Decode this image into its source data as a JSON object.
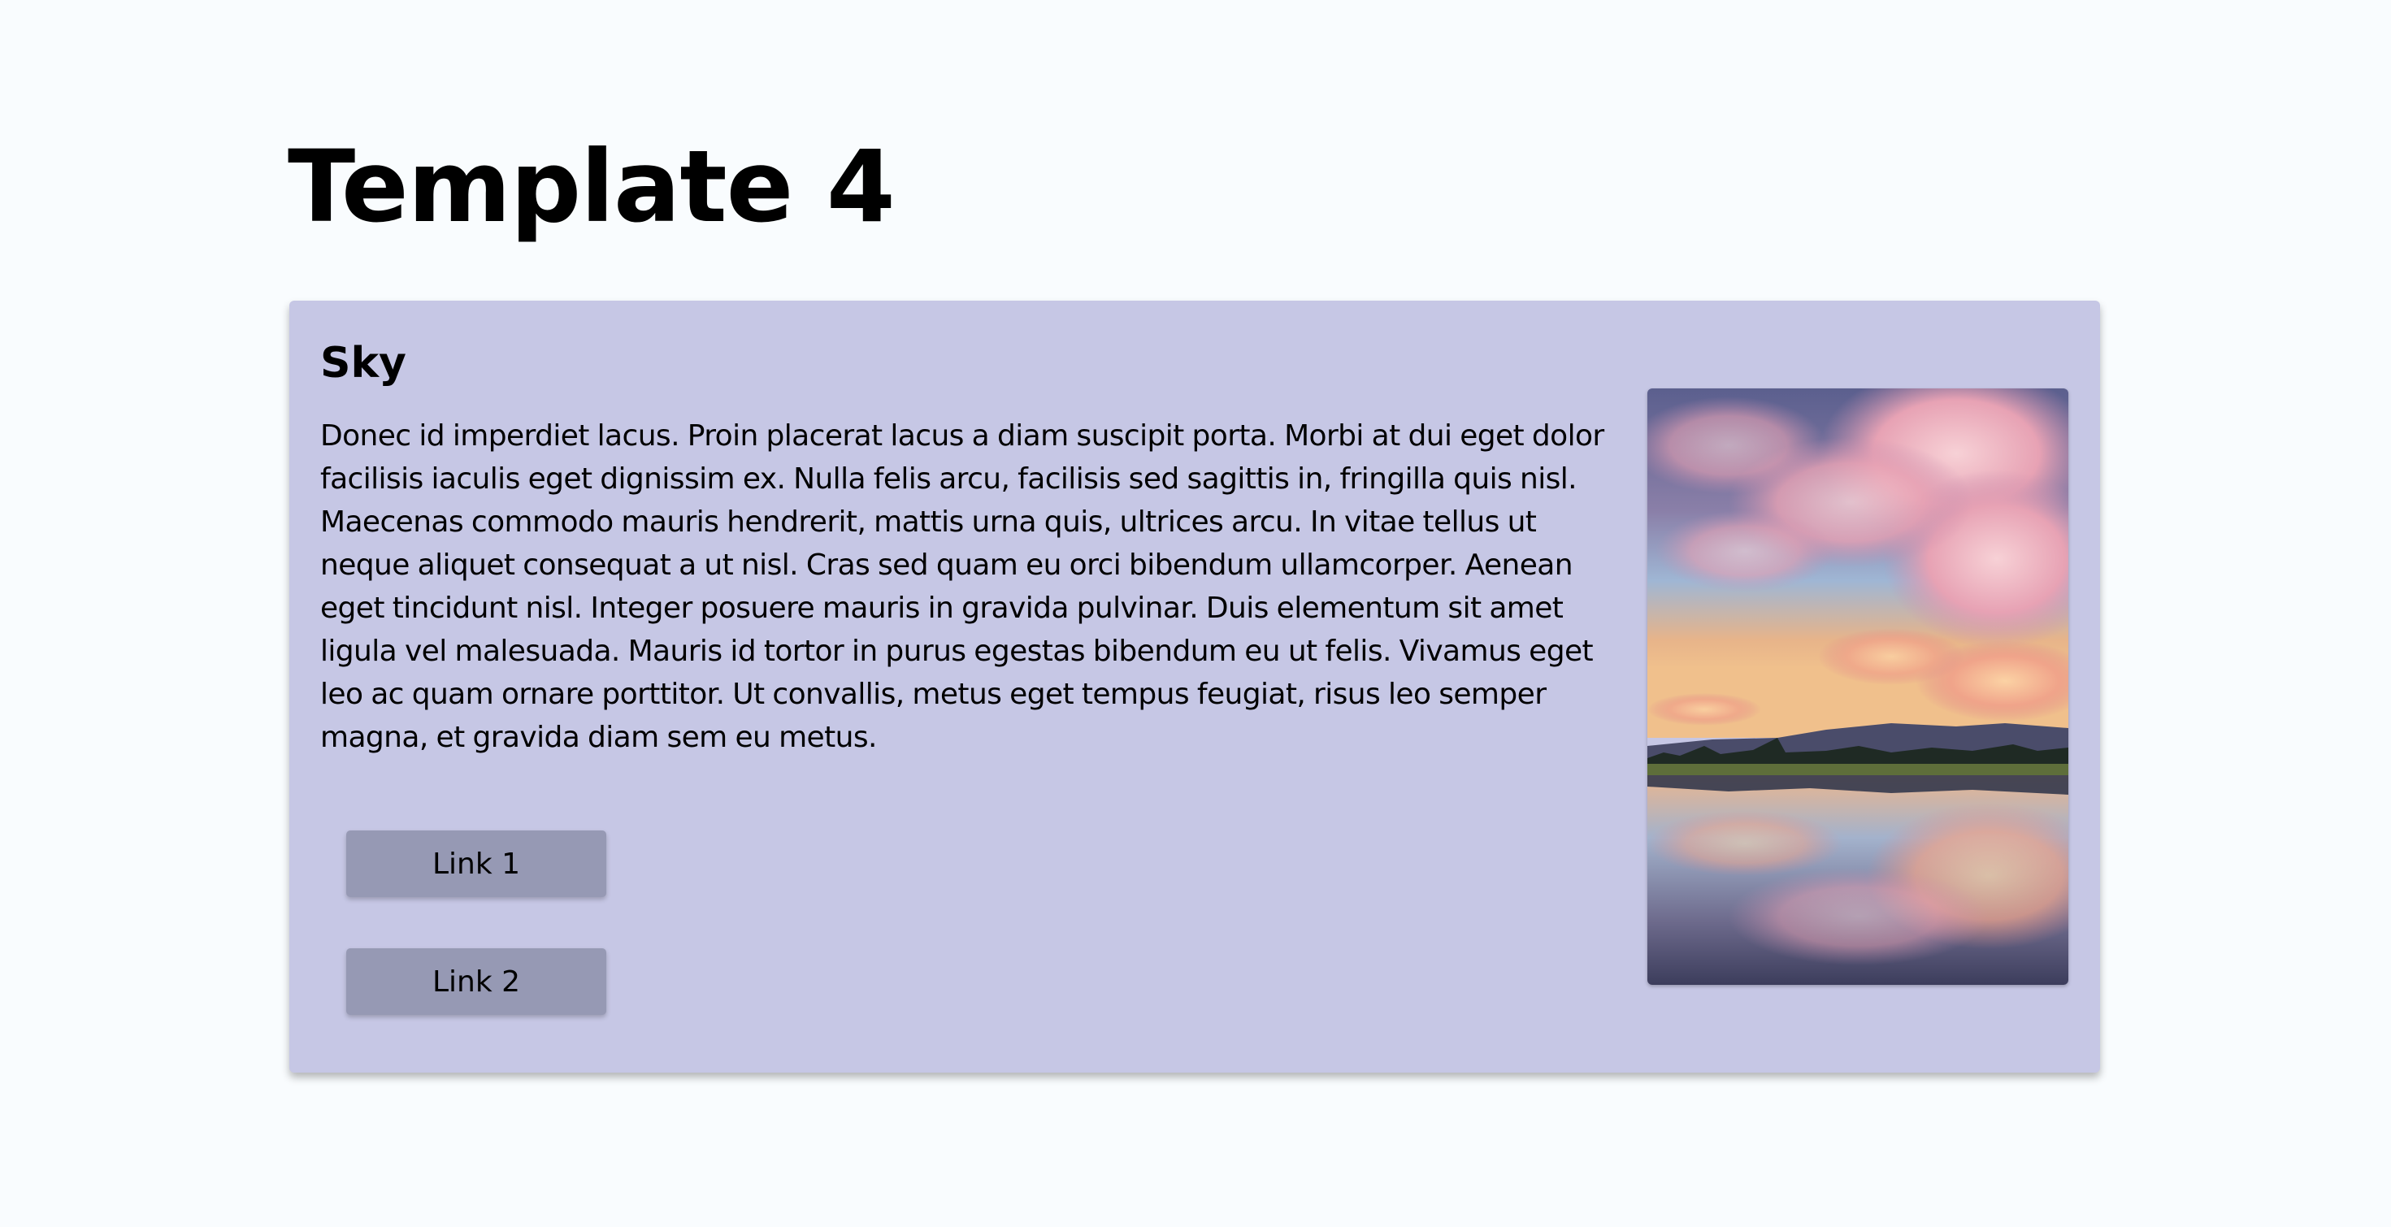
{
  "page": {
    "title": "Template 4"
  },
  "card": {
    "title": "Sky",
    "body": "Donec id imperdiet lacus. Proin placerat lacus a diam suscipit porta. Morbi at dui eget dolor facilisis iaculis eget dignissim ex. Nulla felis arcu, facilisis sed sagittis in, fringilla quis nisl. Maecenas commodo mauris hendrerit, mattis urna quis, ultrices arcu. In vitae tellus ut neque aliquet consequat a ut nisl. Cras sed quam eu orci bibendum ullamcorper. Aenean eget tincidunt nisl. Integer posuere mauris in gravida pulvinar. Duis elementum sit amet ligula vel malesuada. Mauris id tortor in purus egestas bibendum eu ut felis. Vivamus eget leo ac quam ornare porttitor. Ut convallis, metus eget tempus feugiat, risus leo semper magna, et gravida diam sem eu metus.",
    "links": [
      {
        "label": "Link 1"
      },
      {
        "label": "Link 2"
      }
    ],
    "image": {
      "subject": "sunset-sky-reflected-in-lake"
    }
  },
  "colors": {
    "background": "#f9fcfe",
    "card": "#c6c7e5",
    "button": "#9699b4"
  }
}
